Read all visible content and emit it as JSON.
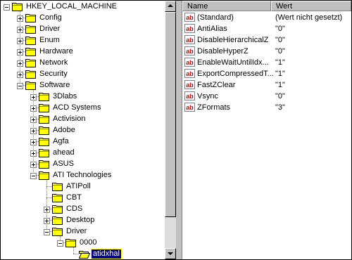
{
  "tree": {
    "root": "HKEY_LOCAL_MACHINE",
    "items": [
      {
        "label": "Config",
        "level": 1,
        "expander": "plus"
      },
      {
        "label": "Driver",
        "level": 1,
        "expander": "plus"
      },
      {
        "label": "Enum",
        "level": 1,
        "expander": "plus"
      },
      {
        "label": "Hardware",
        "level": 1,
        "expander": "plus"
      },
      {
        "label": "Network",
        "level": 1,
        "expander": "plus"
      },
      {
        "label": "Security",
        "level": 1,
        "expander": "plus"
      },
      {
        "label": "Software",
        "level": 1,
        "expander": "minus"
      },
      {
        "label": "3Dlabs",
        "level": 2,
        "expander": "plus"
      },
      {
        "label": "ACD Systems",
        "level": 2,
        "expander": "plus"
      },
      {
        "label": "Activision",
        "level": 2,
        "expander": "plus"
      },
      {
        "label": "Adobe",
        "level": 2,
        "expander": "plus"
      },
      {
        "label": "Agfa",
        "level": 2,
        "expander": "plus"
      },
      {
        "label": "ahead",
        "level": 2,
        "expander": "plus"
      },
      {
        "label": "ASUS",
        "level": 2,
        "expander": "plus"
      },
      {
        "label": "ATI Technologies",
        "level": 2,
        "expander": "minus"
      },
      {
        "label": "ATIPoll",
        "level": 3,
        "expander": "none"
      },
      {
        "label": "CBT",
        "level": 3,
        "expander": "none"
      },
      {
        "label": "CDS",
        "level": 3,
        "expander": "plus"
      },
      {
        "label": "Desktop",
        "level": 3,
        "expander": "plus"
      },
      {
        "label": "Driver",
        "level": 3,
        "expander": "minus"
      },
      {
        "label": "0000",
        "level": 4,
        "expander": "minus"
      },
      {
        "label": "atidxhal",
        "level": 5,
        "expander": "none",
        "selected": true,
        "open": true
      }
    ]
  },
  "list": {
    "columns": [
      "Name",
      "Wert"
    ],
    "rows": [
      {
        "name": "(Standard)",
        "value": "(Wert nicht gesetzt)"
      },
      {
        "name": "AntiAlias",
        "value": "\"0\""
      },
      {
        "name": "DisableHierarchicalZ",
        "value": "\"0\""
      },
      {
        "name": "DisableHyperZ",
        "value": "\"0\""
      },
      {
        "name": "EnableWaitUntilIdx...",
        "value": "\"1\""
      },
      {
        "name": "ExportCompressedT...",
        "value": "\"1\""
      },
      {
        "name": "FastZClear",
        "value": "\"1\""
      },
      {
        "name": "Vsync",
        "value": "\"0\""
      },
      {
        "name": "ZFormats",
        "value": "\"3\""
      }
    ]
  },
  "colors": {
    "selection": "#000080",
    "folder": "#ffff00",
    "string_icon": "#cc0000"
  },
  "icons": {
    "tree_folder": "folder-icon",
    "value_type": "string-value-icon"
  }
}
